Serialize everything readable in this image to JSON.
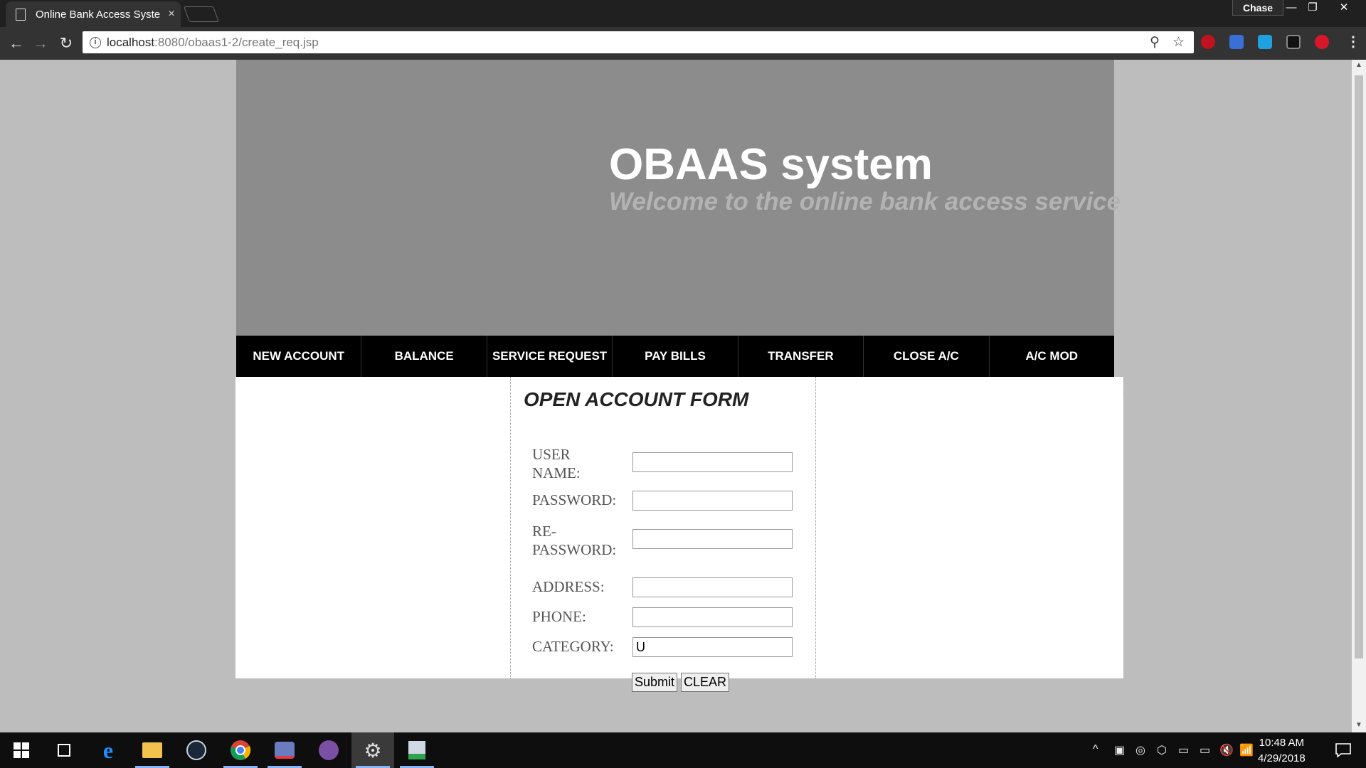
{
  "browser": {
    "tab_title": "Online Bank Access Syste",
    "tab_close": "×",
    "profile_name": "Chase",
    "url_host": "localhost",
    "url_path": ":8080/obaas1-2/create_req.jsp",
    "url_info_glyph": "i",
    "window_controls": [
      "—",
      "❐",
      "✕"
    ],
    "nav": {
      "back": "←",
      "forward": "→",
      "reload": "↻"
    },
    "omnibox_icons": {
      "zoom": "⚲",
      "bookmark": "☆"
    },
    "menu": "⋮"
  },
  "page": {
    "title": "OBAAS system",
    "subtitle": "Welcome to the online bank access service",
    "nav_items": [
      "NEW ACCOUNT",
      "BALANCE",
      "SERVICE REQUEST",
      "PAY BILLS",
      "TRANSFER",
      "CLOSE A/C",
      "A/C MOD"
    ],
    "form": {
      "heading": "OPEN ACCOUNT FORM",
      "labels": {
        "username": "USER NAME:",
        "password": "PASSWORD:",
        "repassword": "RE- PASSWORD:",
        "address": "ADDRESS:",
        "phone": "PHONE:",
        "category": "CATEGORY:"
      },
      "values": {
        "username": "",
        "password": "",
        "repassword": "",
        "address": "",
        "phone": "",
        "category": "U"
      },
      "submit_label": "Submit",
      "clear_label": "CLEAR"
    }
  },
  "taskbar": {
    "time": "10:48 AM",
    "date": "4/29/2018",
    "tray_icons": [
      "^",
      "▣",
      "◎",
      "⬡",
      "▭",
      "▭",
      "🔇",
      "📶"
    ]
  },
  "colors": {
    "header_bg": "#8c8c8c",
    "nav_bg": "#000000",
    "page_bg": "#bdbdbd",
    "subtitle": "#b3b3b3"
  }
}
